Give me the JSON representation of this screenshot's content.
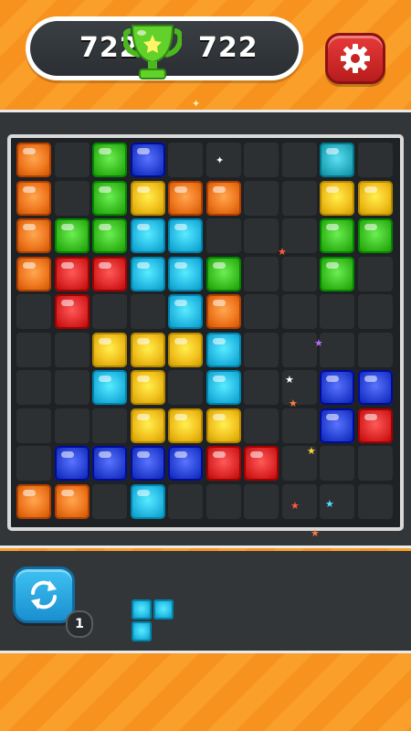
{
  "score": {
    "current": "722",
    "best": "722"
  },
  "rotate": {
    "count": "1"
  },
  "colors": {
    "orange": "#f07a22",
    "green": "#3fc226",
    "blue": "#2d47d8",
    "cyan": "#2bbfe8",
    "yellow": "#f3c321",
    "red": "#e02c2c",
    "teal": "#2fb3c7"
  },
  "board": {
    "rows": 10,
    "cols": 10,
    "cells": [
      "O.GB....T.",
      "O.GYOO..YY",
      "OGGCC...GG",
      "ORRCCG..G.",
      ".R..CO....",
      "..YYYC....",
      "..CY.C..BB",
      "...YYY..BR",
      ".BBBBRR...",
      "OO.C......"
    ]
  },
  "next_piece": {
    "color": "cyan",
    "cells": [
      "XX",
      "X."
    ]
  },
  "icons": {
    "trophy": "trophy-icon",
    "settings": "gear-icon",
    "rotate": "rotate-arrows-icon"
  }
}
